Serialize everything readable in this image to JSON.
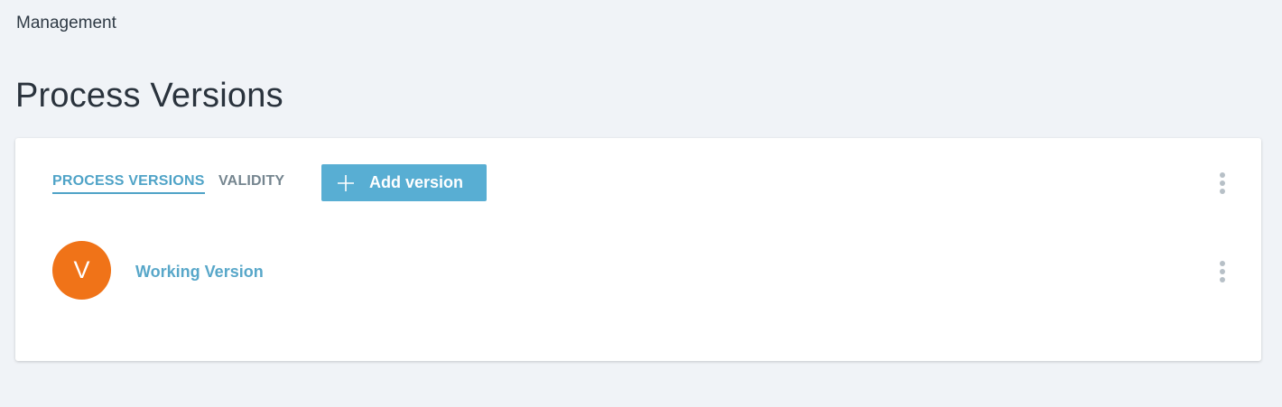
{
  "breadcrumb": {
    "label": "Management"
  },
  "page": {
    "title": "Process Versions"
  },
  "tabs": [
    {
      "label": "PROCESS VERSIONS",
      "active": true
    },
    {
      "label": "VALIDITY",
      "active": false
    }
  ],
  "toolbar": {
    "add_label": "Add version",
    "add_icon": "plus-icon",
    "menu_icon": "vertical-dots-icon"
  },
  "versions": [
    {
      "avatar_letter": "V",
      "avatar_color": "#f07318",
      "name": "Working Version",
      "menu_icon": "vertical-dots-icon"
    }
  ],
  "colors": {
    "background": "#f0f3f7",
    "accent": "#4fa3c7",
    "button": "#58aed3",
    "avatar": "#f07318",
    "inactive_tab": "#75858f"
  }
}
